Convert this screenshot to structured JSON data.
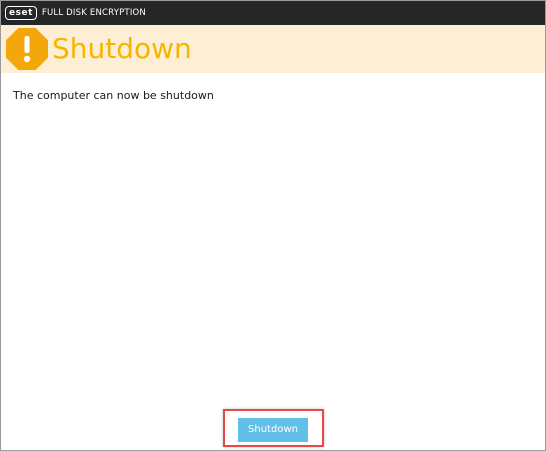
{
  "titlebar": {
    "logo_text": "eset",
    "product_name": "FULL DISK ENCRYPTION"
  },
  "header": {
    "icon": "warning-icon",
    "title": "Shutdown"
  },
  "content": {
    "message": "The computer can now be shutdown"
  },
  "actions": {
    "shutdown_label": "Shutdown"
  },
  "colors": {
    "titlebar_bg": "#252627",
    "header_bg": "#fcefd6",
    "accent_orange": "#f7b500",
    "button_blue": "#62bfe9",
    "highlight_red": "#e8474b"
  }
}
